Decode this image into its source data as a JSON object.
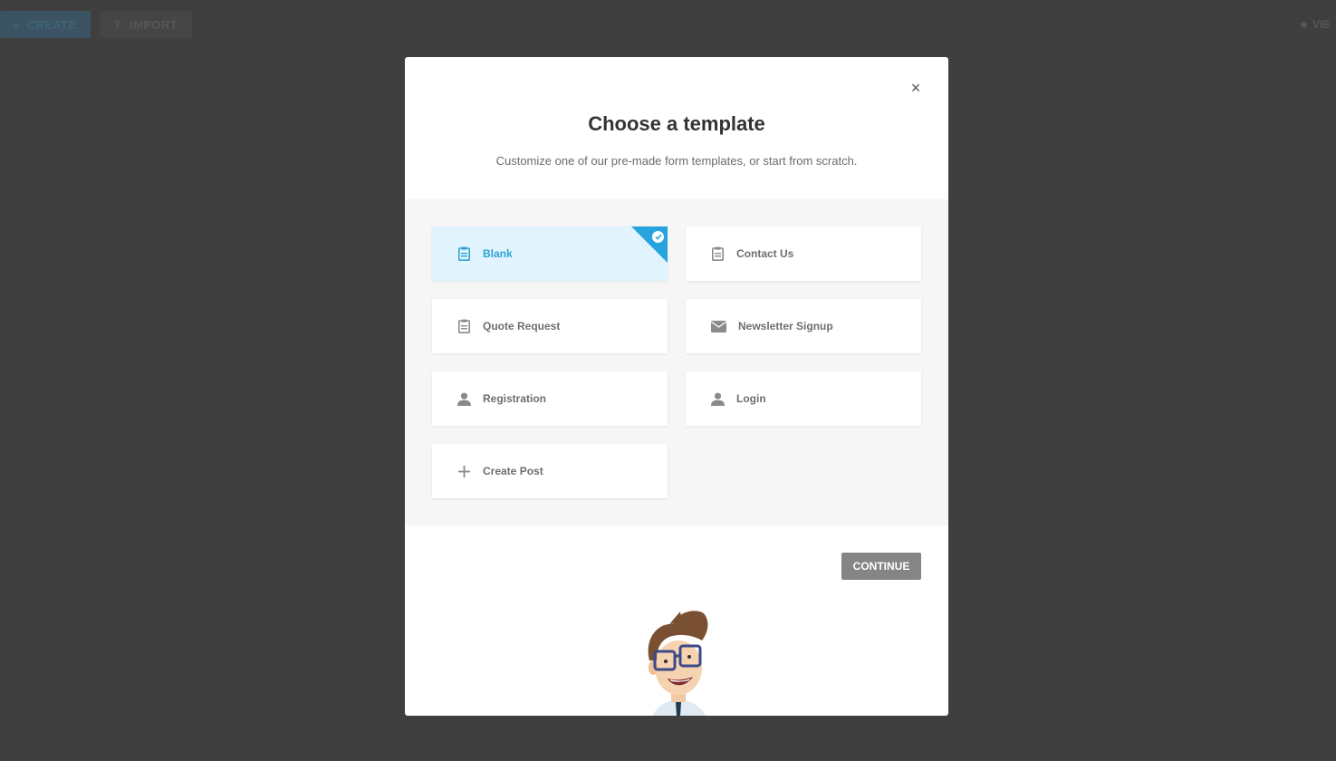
{
  "background": {
    "create_label": "CREATE",
    "import_label": "IMPORT",
    "right_label": "VIE"
  },
  "modal": {
    "title": "Choose a template",
    "subtitle": "Customize one of our pre-made form templates, or start from scratch.",
    "close_icon": "close-icon",
    "continue_label": "CONTINUE"
  },
  "templates": [
    {
      "label": "Blank",
      "icon": "clipboard-icon",
      "selected": true
    },
    {
      "label": "Contact Us",
      "icon": "clipboard-icon",
      "selected": false
    },
    {
      "label": "Quote Request",
      "icon": "clipboard-icon",
      "selected": false
    },
    {
      "label": "Newsletter Signup",
      "icon": "envelope-icon",
      "selected": false
    },
    {
      "label": "Registration",
      "icon": "user-icon",
      "selected": false
    },
    {
      "label": "Login",
      "icon": "user-icon",
      "selected": false
    },
    {
      "label": "Create Post",
      "icon": "plus-icon",
      "selected": false
    }
  ],
  "colors": {
    "accent": "#27a4dd",
    "selected_bg": "#e1f4fd",
    "continue_bg": "#858585",
    "overlay": "#3f3f3f"
  }
}
